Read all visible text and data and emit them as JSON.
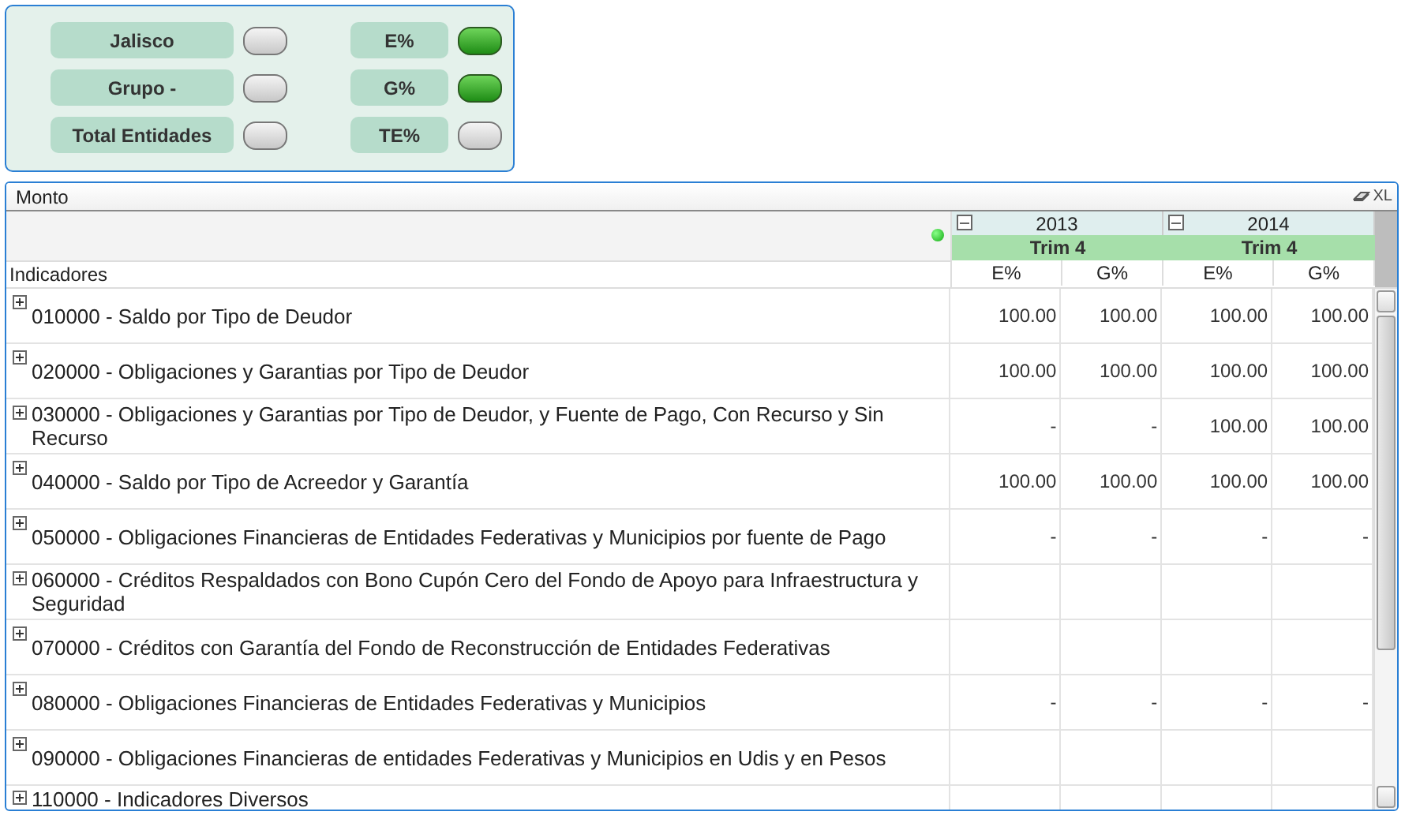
{
  "selectors": [
    {
      "label": "Jalisco",
      "on": false
    },
    {
      "label": "E%",
      "on": true
    },
    {
      "label": "Grupo -",
      "on": false
    },
    {
      "label": "G%",
      "on": true
    },
    {
      "label": "Total Entidades",
      "on": false
    },
    {
      "label": "TE%",
      "on": false
    }
  ],
  "table": {
    "title": "Monto",
    "xl_label": "XL",
    "row_header": "Indicadores",
    "years": [
      {
        "year": "2013",
        "quarter": "Trim 4",
        "columns": [
          "E%",
          "G%"
        ]
      },
      {
        "year": "2014",
        "quarter": "Trim 4",
        "columns": [
          "E%",
          "G%"
        ]
      }
    ],
    "rows": [
      {
        "label": "010000 - Saldo por Tipo de Deudor",
        "values": [
          "100.00",
          "100.00",
          "100.00",
          "100.00"
        ]
      },
      {
        "label": "020000 - Obligaciones y Garantias por Tipo de Deudor",
        "values": [
          "100.00",
          "100.00",
          "100.00",
          "100.00"
        ]
      },
      {
        "label": "030000 - Obligaciones y Garantias por Tipo de Deudor, y Fuente de Pago, Con Recurso y Sin Recurso",
        "values": [
          "-",
          "-",
          "100.00",
          "100.00"
        ]
      },
      {
        "label": "040000 - Saldo por Tipo de Acreedor y Garantía",
        "values": [
          "100.00",
          "100.00",
          "100.00",
          "100.00"
        ]
      },
      {
        "label": "050000 - Obligaciones Financieras de Entidades Federativas y Municipios por fuente de Pago",
        "values": [
          "-",
          "-",
          "-",
          "-"
        ]
      },
      {
        "label": "060000 - Créditos Respaldados con Bono Cupón Cero del Fondo de Apoyo para Infraestructura y Seguridad"
      },
      {
        "label": "070000 - Créditos con Garantía del Fondo de Reconstrucción de Entidades Federativas"
      },
      {
        "label": "080000 - Obligaciones Financieras de Entidades Federativas y Municipios",
        "values": [
          "-",
          "-",
          "-",
          "-"
        ]
      },
      {
        "label": "090000 - Obligaciones Financieras de entidades Federativas y Municipios en Udis y en Pesos"
      },
      {
        "label": "110000 - Indicadores Diversos"
      }
    ]
  }
}
